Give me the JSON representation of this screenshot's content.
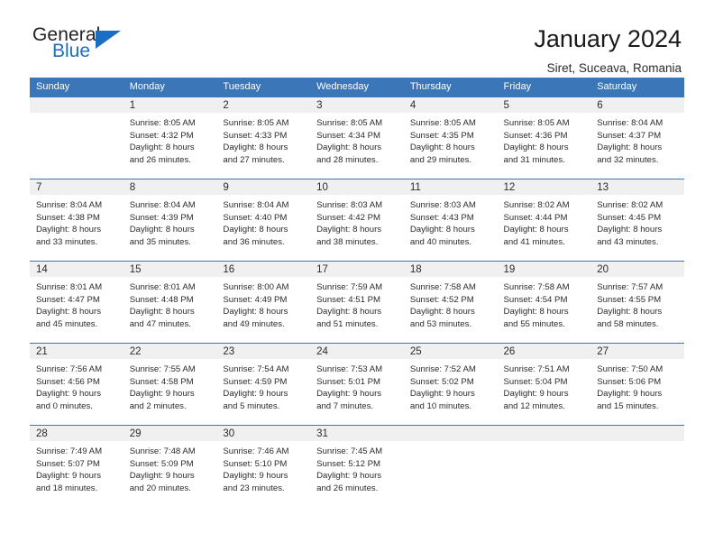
{
  "brand": {
    "name_part1": "General",
    "name_part2": "Blue",
    "triangle_icon": "triangle-icon",
    "accent_color": "#1b6ec2"
  },
  "header": {
    "title": "January 2024",
    "subtitle": "Siret, Suceava, Romania"
  },
  "calendar": {
    "header_bg": "#3a76b8",
    "daynum_bg": "#f0f0f0",
    "weekday_headers": [
      "Sunday",
      "Monday",
      "Tuesday",
      "Wednesday",
      "Thursday",
      "Friday",
      "Saturday"
    ],
    "weeks": [
      [
        {
          "day": "",
          "sunrise": "",
          "sunset": "",
          "daylight1": "",
          "daylight2": ""
        },
        {
          "day": "1",
          "sunrise": "Sunrise: 8:05 AM",
          "sunset": "Sunset: 4:32 PM",
          "daylight1": "Daylight: 8 hours",
          "daylight2": "and 26 minutes."
        },
        {
          "day": "2",
          "sunrise": "Sunrise: 8:05 AM",
          "sunset": "Sunset: 4:33 PM",
          "daylight1": "Daylight: 8 hours",
          "daylight2": "and 27 minutes."
        },
        {
          "day": "3",
          "sunrise": "Sunrise: 8:05 AM",
          "sunset": "Sunset: 4:34 PM",
          "daylight1": "Daylight: 8 hours",
          "daylight2": "and 28 minutes."
        },
        {
          "day": "4",
          "sunrise": "Sunrise: 8:05 AM",
          "sunset": "Sunset: 4:35 PM",
          "daylight1": "Daylight: 8 hours",
          "daylight2": "and 29 minutes."
        },
        {
          "day": "5",
          "sunrise": "Sunrise: 8:05 AM",
          "sunset": "Sunset: 4:36 PM",
          "daylight1": "Daylight: 8 hours",
          "daylight2": "and 31 minutes."
        },
        {
          "day": "6",
          "sunrise": "Sunrise: 8:04 AM",
          "sunset": "Sunset: 4:37 PM",
          "daylight1": "Daylight: 8 hours",
          "daylight2": "and 32 minutes."
        }
      ],
      [
        {
          "day": "7",
          "sunrise": "Sunrise: 8:04 AM",
          "sunset": "Sunset: 4:38 PM",
          "daylight1": "Daylight: 8 hours",
          "daylight2": "and 33 minutes."
        },
        {
          "day": "8",
          "sunrise": "Sunrise: 8:04 AM",
          "sunset": "Sunset: 4:39 PM",
          "daylight1": "Daylight: 8 hours",
          "daylight2": "and 35 minutes."
        },
        {
          "day": "9",
          "sunrise": "Sunrise: 8:04 AM",
          "sunset": "Sunset: 4:40 PM",
          "daylight1": "Daylight: 8 hours",
          "daylight2": "and 36 minutes."
        },
        {
          "day": "10",
          "sunrise": "Sunrise: 8:03 AM",
          "sunset": "Sunset: 4:42 PM",
          "daylight1": "Daylight: 8 hours",
          "daylight2": "and 38 minutes."
        },
        {
          "day": "11",
          "sunrise": "Sunrise: 8:03 AM",
          "sunset": "Sunset: 4:43 PM",
          "daylight1": "Daylight: 8 hours",
          "daylight2": "and 40 minutes."
        },
        {
          "day": "12",
          "sunrise": "Sunrise: 8:02 AM",
          "sunset": "Sunset: 4:44 PM",
          "daylight1": "Daylight: 8 hours",
          "daylight2": "and 41 minutes."
        },
        {
          "day": "13",
          "sunrise": "Sunrise: 8:02 AM",
          "sunset": "Sunset: 4:45 PM",
          "daylight1": "Daylight: 8 hours",
          "daylight2": "and 43 minutes."
        }
      ],
      [
        {
          "day": "14",
          "sunrise": "Sunrise: 8:01 AM",
          "sunset": "Sunset: 4:47 PM",
          "daylight1": "Daylight: 8 hours",
          "daylight2": "and 45 minutes."
        },
        {
          "day": "15",
          "sunrise": "Sunrise: 8:01 AM",
          "sunset": "Sunset: 4:48 PM",
          "daylight1": "Daylight: 8 hours",
          "daylight2": "and 47 minutes."
        },
        {
          "day": "16",
          "sunrise": "Sunrise: 8:00 AM",
          "sunset": "Sunset: 4:49 PM",
          "daylight1": "Daylight: 8 hours",
          "daylight2": "and 49 minutes."
        },
        {
          "day": "17",
          "sunrise": "Sunrise: 7:59 AM",
          "sunset": "Sunset: 4:51 PM",
          "daylight1": "Daylight: 8 hours",
          "daylight2": "and 51 minutes."
        },
        {
          "day": "18",
          "sunrise": "Sunrise: 7:58 AM",
          "sunset": "Sunset: 4:52 PM",
          "daylight1": "Daylight: 8 hours",
          "daylight2": "and 53 minutes."
        },
        {
          "day": "19",
          "sunrise": "Sunrise: 7:58 AM",
          "sunset": "Sunset: 4:54 PM",
          "daylight1": "Daylight: 8 hours",
          "daylight2": "and 55 minutes."
        },
        {
          "day": "20",
          "sunrise": "Sunrise: 7:57 AM",
          "sunset": "Sunset: 4:55 PM",
          "daylight1": "Daylight: 8 hours",
          "daylight2": "and 58 minutes."
        }
      ],
      [
        {
          "day": "21",
          "sunrise": "Sunrise: 7:56 AM",
          "sunset": "Sunset: 4:56 PM",
          "daylight1": "Daylight: 9 hours",
          "daylight2": "and 0 minutes."
        },
        {
          "day": "22",
          "sunrise": "Sunrise: 7:55 AM",
          "sunset": "Sunset: 4:58 PM",
          "daylight1": "Daylight: 9 hours",
          "daylight2": "and 2 minutes."
        },
        {
          "day": "23",
          "sunrise": "Sunrise: 7:54 AM",
          "sunset": "Sunset: 4:59 PM",
          "daylight1": "Daylight: 9 hours",
          "daylight2": "and 5 minutes."
        },
        {
          "day": "24",
          "sunrise": "Sunrise: 7:53 AM",
          "sunset": "Sunset: 5:01 PM",
          "daylight1": "Daylight: 9 hours",
          "daylight2": "and 7 minutes."
        },
        {
          "day": "25",
          "sunrise": "Sunrise: 7:52 AM",
          "sunset": "Sunset: 5:02 PM",
          "daylight1": "Daylight: 9 hours",
          "daylight2": "and 10 minutes."
        },
        {
          "day": "26",
          "sunrise": "Sunrise: 7:51 AM",
          "sunset": "Sunset: 5:04 PM",
          "daylight1": "Daylight: 9 hours",
          "daylight2": "and 12 minutes."
        },
        {
          "day": "27",
          "sunrise": "Sunrise: 7:50 AM",
          "sunset": "Sunset: 5:06 PM",
          "daylight1": "Daylight: 9 hours",
          "daylight2": "and 15 minutes."
        }
      ],
      [
        {
          "day": "28",
          "sunrise": "Sunrise: 7:49 AM",
          "sunset": "Sunset: 5:07 PM",
          "daylight1": "Daylight: 9 hours",
          "daylight2": "and 18 minutes."
        },
        {
          "day": "29",
          "sunrise": "Sunrise: 7:48 AM",
          "sunset": "Sunset: 5:09 PM",
          "daylight1": "Daylight: 9 hours",
          "daylight2": "and 20 minutes."
        },
        {
          "day": "30",
          "sunrise": "Sunrise: 7:46 AM",
          "sunset": "Sunset: 5:10 PM",
          "daylight1": "Daylight: 9 hours",
          "daylight2": "and 23 minutes."
        },
        {
          "day": "31",
          "sunrise": "Sunrise: 7:45 AM",
          "sunset": "Sunset: 5:12 PM",
          "daylight1": "Daylight: 9 hours",
          "daylight2": "and 26 minutes."
        },
        {
          "day": "",
          "sunrise": "",
          "sunset": "",
          "daylight1": "",
          "daylight2": ""
        },
        {
          "day": "",
          "sunrise": "",
          "sunset": "",
          "daylight1": "",
          "daylight2": ""
        },
        {
          "day": "",
          "sunrise": "",
          "sunset": "",
          "daylight1": "",
          "daylight2": ""
        }
      ]
    ]
  }
}
